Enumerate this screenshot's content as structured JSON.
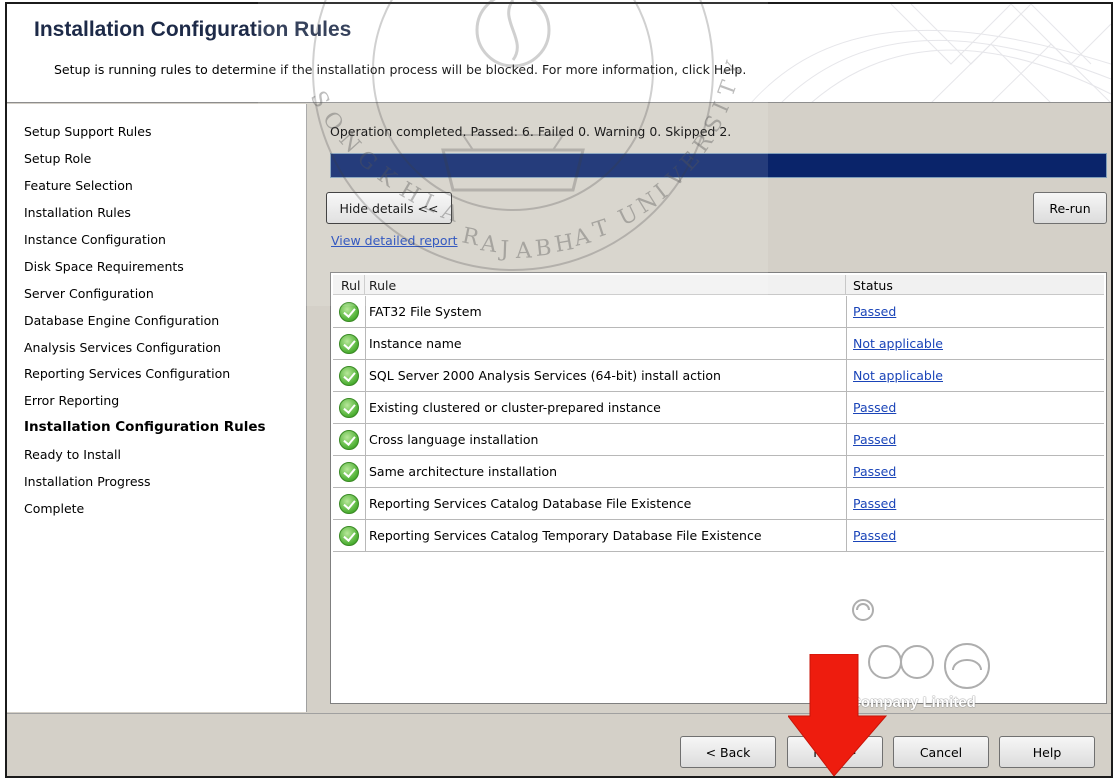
{
  "header": {
    "title": "Installation Configuration Rules",
    "subtitle": "Setup is running rules to determine if the installation process will be blocked. For more information, click Help."
  },
  "nav": {
    "items": [
      {
        "label": "Setup Support Rules",
        "active": false
      },
      {
        "label": "Setup Role",
        "active": false
      },
      {
        "label": "Feature Selection",
        "active": false
      },
      {
        "label": "Installation Rules",
        "active": false
      },
      {
        "label": "Instance Configuration",
        "active": false
      },
      {
        "label": "Disk Space Requirements",
        "active": false
      },
      {
        "label": "Server Configuration",
        "active": false
      },
      {
        "label": "Database Engine Configuration",
        "active": false
      },
      {
        "label": "Analysis Services Configuration",
        "active": false
      },
      {
        "label": "Reporting Services Configuration",
        "active": false
      },
      {
        "label": "Error Reporting",
        "active": false
      },
      {
        "label": "Installation Configuration Rules",
        "active": true
      },
      {
        "label": "Ready to Install",
        "active": false
      },
      {
        "label": "Installation Progress",
        "active": false
      },
      {
        "label": "Complete",
        "active": false
      }
    ]
  },
  "content": {
    "operation_status": "Operation completed. Passed: 6.   Failed 0.   Warning 0.   Skipped 2.",
    "progress": 1.0,
    "hide_details_label": "Hide details <<",
    "rerun_label": "Re-run",
    "view_report_label": "View detailed report"
  },
  "table": {
    "columns": {
      "icon": "Rul",
      "rule": "Rule",
      "status": "Status"
    },
    "rows": [
      {
        "icon": "check-icon",
        "rule": "FAT32 File System",
        "status": "Passed"
      },
      {
        "icon": "check-icon",
        "rule": "Instance name",
        "status": "Not applicable"
      },
      {
        "icon": "check-icon",
        "rule": "SQL Server 2000 Analysis Services (64-bit) install action",
        "status": "Not applicable"
      },
      {
        "icon": "check-icon",
        "rule": "Existing clustered or cluster-prepared instance",
        "status": "Passed"
      },
      {
        "icon": "check-icon",
        "rule": "Cross language installation",
        "status": "Passed"
      },
      {
        "icon": "check-icon",
        "rule": "Same architecture installation",
        "status": "Passed"
      },
      {
        "icon": "check-icon",
        "rule": "Reporting Services Catalog Database File Existence",
        "status": "Passed"
      },
      {
        "icon": "check-icon",
        "rule": "Reporting Services Catalog Temporary Database File Existence",
        "status": "Passed"
      }
    ]
  },
  "footer": {
    "back_label": "< Back",
    "next_label": "Next >",
    "cancel_label": "Cancel",
    "help_label": "Help"
  },
  "watermark": {
    "seal_text_top": "SONGKHLA RAJABHAT UNIVERSITY",
    "company_text": "Company Limited"
  },
  "colors": {
    "title": "#1d2a48",
    "progress": "#0a246a",
    "link": "#1a44b8",
    "arrow": "#ee1c0e",
    "check": "#4caf32"
  }
}
